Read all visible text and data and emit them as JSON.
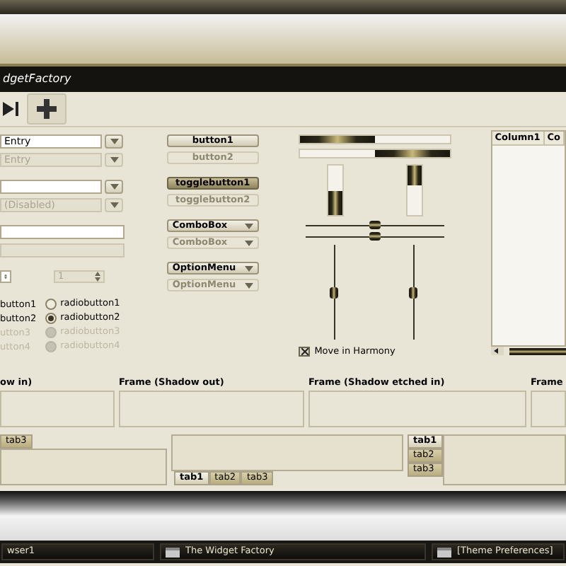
{
  "title_bar": {
    "title": "dgetFactory"
  },
  "entries": [
    {
      "kind": "combo",
      "value": "Entry",
      "disabled": false
    },
    {
      "kind": "combo",
      "value": "Entry",
      "disabled": true
    },
    {
      "kind": "combo",
      "disabled": false
    },
    {
      "kind": "combo",
      "value": "(Disabled)",
      "disabled": true
    },
    {
      "kind": "plain",
      "disabled": false
    },
    {
      "kind": "plain",
      "disabled": true
    }
  ],
  "spins": [
    {
      "disabled": false
    },
    {
      "value": "1",
      "disabled": true
    }
  ],
  "checks": [
    {
      "label": "button1",
      "disabled": false
    },
    {
      "label": "button2",
      "disabled": false
    },
    {
      "label": "utton3",
      "disabled": true
    },
    {
      "label": "utton4",
      "disabled": true
    }
  ],
  "radios": [
    {
      "label": "radiobutton1",
      "selected": false,
      "disabled": false
    },
    {
      "label": "radiobutton2",
      "selected": true,
      "disabled": false
    },
    {
      "label": "radiobutton3",
      "selected": false,
      "disabled": true
    },
    {
      "label": "radiobutton4",
      "selected": false,
      "disabled": true
    }
  ],
  "buttons": [
    {
      "kind": "button",
      "label": "button1",
      "disabled": false,
      "active": false
    },
    {
      "kind": "button",
      "label": "button2",
      "disabled": true,
      "active": false
    },
    {
      "kind": "toggle",
      "label": "togglebutton1",
      "disabled": false,
      "active": true
    },
    {
      "kind": "toggle",
      "label": "togglebutton2",
      "disabled": true,
      "active": false
    },
    {
      "kind": "combo",
      "label": "ComboBox",
      "disabled": false,
      "active": false
    },
    {
      "kind": "combo",
      "label": "ComboBox",
      "disabled": true,
      "active": false
    },
    {
      "kind": "option",
      "label": "OptionMenu",
      "disabled": false,
      "active": false
    },
    {
      "kind": "option",
      "label": "OptionMenu",
      "disabled": true,
      "active": false
    }
  ],
  "progress_bars": [
    {
      "kind": "ltr",
      "level": 0.5
    },
    {
      "kind": "rtl",
      "level": 0.5
    }
  ],
  "vertical_progress_bars": [
    {
      "kind": "btt",
      "level": 0.48
    },
    {
      "kind": "ttb",
      "level": 0.4
    }
  ],
  "scales": [
    {
      "level": 0.5
    },
    {
      "level": 0.5
    }
  ],
  "vertical_scales": [
    {
      "level": 0.5
    },
    {
      "level": 0.5
    }
  ],
  "harmony": {
    "label": "Move in Harmony",
    "checked": true
  },
  "tree": {
    "columns": [
      "Column1",
      "Co"
    ]
  },
  "frames": [
    {
      "label": "ow in)"
    },
    {
      "label": "Frame (Shadow out)"
    },
    {
      "label": "Frame (Shadow etched in)"
    },
    {
      "label": "Frame"
    }
  ],
  "notebooks": [
    {
      "kind": "top",
      "tabs": [
        {
          "label": "tab3",
          "selected": false
        }
      ]
    },
    {
      "kind": "bottom",
      "tabs": [
        {
          "label": "tab1",
          "selected": true
        },
        {
          "label": "tab2",
          "selected": false
        },
        {
          "label": "tab3",
          "selected": false
        }
      ]
    },
    {
      "kind": "left",
      "tabs": [
        {
          "label": "tab1",
          "selected": true
        },
        {
          "label": "tab2",
          "selected": false
        },
        {
          "label": "tab3",
          "selected": false
        }
      ]
    }
  ],
  "taskbar": [
    {
      "label": "wser1",
      "icon": false
    },
    {
      "label": "The Widget Factory",
      "icon": true
    },
    {
      "label": "[Theme Preferences]",
      "icon": true
    }
  ]
}
